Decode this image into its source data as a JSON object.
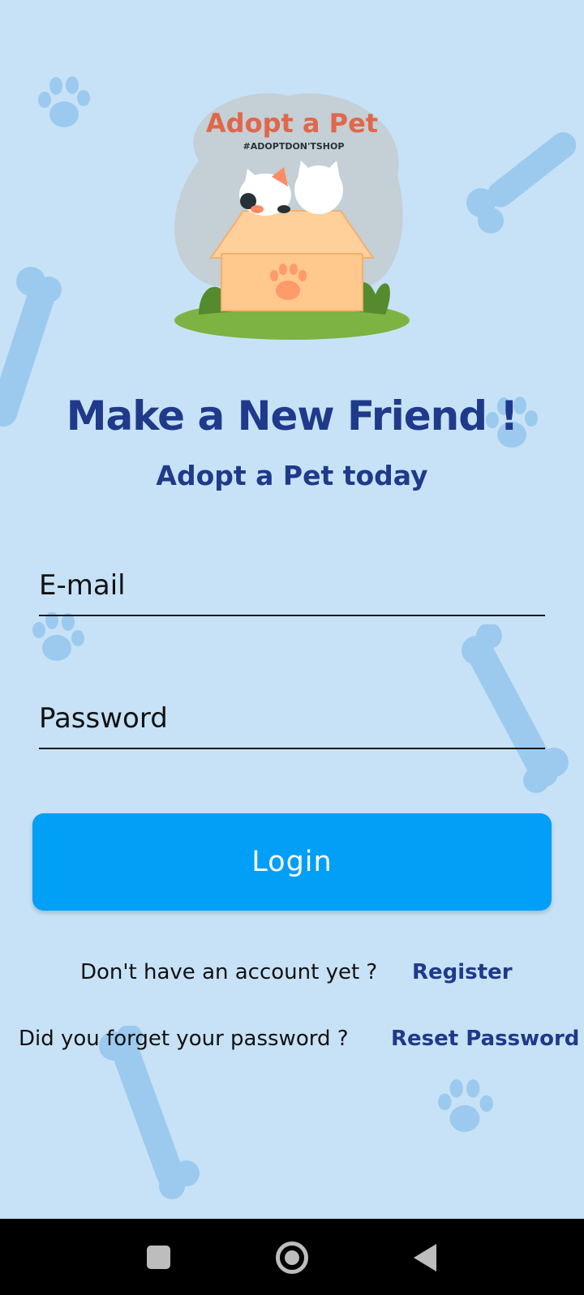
{
  "logo": {
    "title": "Adopt a Pet",
    "hashtag": "#ADOPTDON'TSHOP"
  },
  "heading": {
    "title": "Make a New Friend  !",
    "subtitle": "Adopt a Pet today"
  },
  "form": {
    "email_placeholder": "E-mail",
    "password_placeholder": "Password",
    "login_label": "Login"
  },
  "links": {
    "register_question": "Don't have an account yet ?",
    "register_label": "Register",
    "reset_question": "Did you forget your password ?",
    "reset_label": "Reset Password"
  },
  "colors": {
    "background": "#c7e2f6",
    "accent": "#029ff7",
    "heading": "#1f3a8a",
    "decoration": "#9ccaef"
  },
  "icons": [
    "paw-print-icon",
    "bone-icon",
    "nav-recents-icon",
    "nav-home-icon",
    "nav-back-icon"
  ]
}
